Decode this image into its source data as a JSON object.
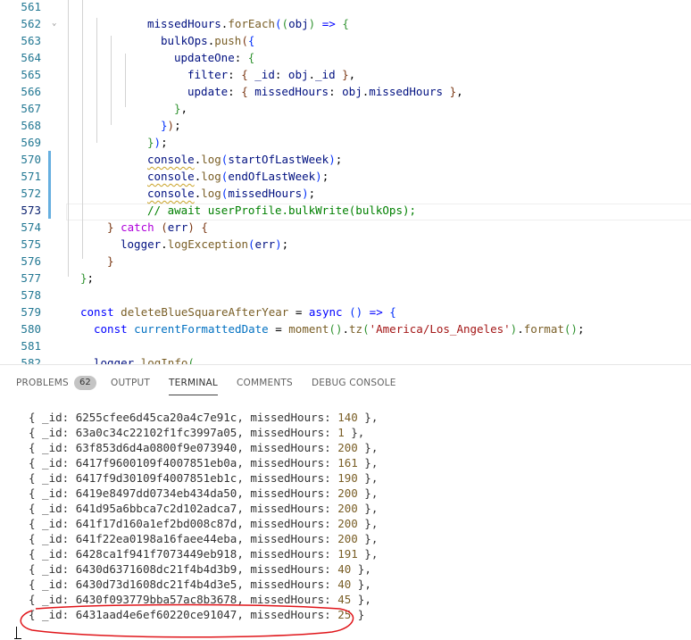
{
  "editor": {
    "lines": [
      {
        "n": "561"
      },
      {
        "n": "562"
      },
      {
        "n": "563"
      },
      {
        "n": "564"
      },
      {
        "n": "565"
      },
      {
        "n": "566"
      },
      {
        "n": "567"
      },
      {
        "n": "568"
      },
      {
        "n": "569"
      },
      {
        "n": "570"
      },
      {
        "n": "571"
      },
      {
        "n": "572"
      },
      {
        "n": "573"
      },
      {
        "n": "574"
      },
      {
        "n": "575"
      },
      {
        "n": "576"
      },
      {
        "n": "577"
      },
      {
        "n": "578"
      },
      {
        "n": "579"
      },
      {
        "n": "580"
      },
      {
        "n": "581"
      },
      {
        "n": "582"
      }
    ],
    "tokens": {
      "missedHours": "missedHours",
      "forEach": "forEach",
      "obj": "obj",
      "arrow": "=>",
      "bulkOps": "bulkOps",
      "push": "push",
      "updateOne": "updateOne",
      "filter": "filter",
      "_id": "_id",
      "update": "update",
      "console": "console",
      "log": "log",
      "startOfLastWeek": "startOfLastWeek",
      "endOfLastWeek": "endOfLastWeek",
      "comment573": "// await userProfile.bulkWrite(bulkOps);",
      "catch": "catch",
      "err": "err",
      "logger": "logger",
      "logException": "logException",
      "const": "const",
      "deleteBlueSquareAfterYear": "deleteBlueSquareAfterYear",
      "async": "async",
      "currentFormattedDate": "currentFormattedDate",
      "moment": "moment",
      "tz": "tz",
      "tzArg": "'America/Los_Angeles'",
      "format": "format",
      "logInfo": "logInfo"
    }
  },
  "panel": {
    "tabs": {
      "problems": "PROBLEMS",
      "problems_count": "62",
      "output": "OUTPUT",
      "terminal": "TERMINAL",
      "comments": "COMMENTS",
      "debug_console": "DEBUG CONSOLE"
    },
    "terminal_rows": [
      {
        "id": "6255cfee6d45ca20a4c7e91c",
        "hours": "140"
      },
      {
        "id": "63a0c34c22102f1fc3997a05",
        "hours": "1"
      },
      {
        "id": "63f853d6d4a0800f9e073940",
        "hours": "200"
      },
      {
        "id": "6417f9600109f4007851eb0a",
        "hours": "161"
      },
      {
        "id": "6417f9d30109f4007851eb1c",
        "hours": "190"
      },
      {
        "id": "6419e8497dd0734eb434da50",
        "hours": "200"
      },
      {
        "id": "641d95a6bbca7c2d102adca7",
        "hours": "200"
      },
      {
        "id": "641f17d160a1ef2bd008c87d",
        "hours": "200"
      },
      {
        "id": "641f22ea0198a16faee44eba",
        "hours": "200"
      },
      {
        "id": "6428ca1f941f7073449eb918",
        "hours": "191"
      },
      {
        "id": "6430d6371608dc21f4b4d3b9",
        "hours": "40"
      },
      {
        "id": "6430d73d1608dc21f4b4d3e5",
        "hours": "40"
      },
      {
        "id": "6430f093779bba57ac8b3678",
        "hours": "45"
      },
      {
        "id": "6431aad4e6ef60220ce91047",
        "hours": "25",
        "last": true
      }
    ],
    "row_prefix": "{ _id: ",
    "row_mid": ", missedHours: ",
    "row_suffix": " },",
    "row_suffix_last": " }"
  },
  "colors": {
    "annotation_circle": "#e0161b",
    "modified_bar": "#66afe0",
    "number": "#795e26"
  }
}
